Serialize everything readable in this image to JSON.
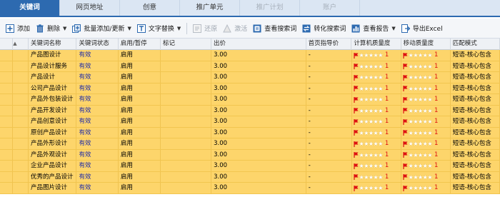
{
  "tabs": [
    {
      "label": "关键词",
      "state": "active"
    },
    {
      "label": "网页地址",
      "state": "normal"
    },
    {
      "label": "创意",
      "state": "normal"
    },
    {
      "label": "推广单元",
      "state": "normal"
    },
    {
      "label": "推广计划",
      "state": "disabled"
    },
    {
      "label": "账户",
      "state": "disabled"
    }
  ],
  "toolbar": {
    "add": "添加",
    "delete": "删除",
    "batch_add": "批量添加/更新",
    "text_replace": "文字替换",
    "restore": "还原",
    "activate": "激活",
    "view_search_terms": "查看搜索词",
    "convert_search_terms": "转化搜索词",
    "view_report": "查看报告",
    "export_excel": "导出Excel"
  },
  "columns": {
    "keyword_name": "关键词名称",
    "keyword_status": "关键词状态",
    "enable_pause": "启用/暂停",
    "mark": "标记",
    "bid": "出价",
    "first_page_bid": "首页指导价",
    "pc_quality": "计算机质量度",
    "mobile_quality": "移动质量度",
    "match_mode": "匹配模式"
  },
  "rows": [
    {
      "keyword": "产品图设计",
      "status": "有效",
      "enabled": "启用",
      "mark": "",
      "bid": "3.00",
      "guide": "-",
      "pc_quality": 1,
      "mobile_quality": 1,
      "match": "短语-核心包含"
    },
    {
      "keyword": "产品设计服务",
      "status": "有效",
      "enabled": "启用",
      "mark": "",
      "bid": "3.00",
      "guide": "-",
      "pc_quality": 1,
      "mobile_quality": 1,
      "match": "短语-核心包含"
    },
    {
      "keyword": "产品设计",
      "status": "有效",
      "enabled": "启用",
      "mark": "",
      "bid": "3.00",
      "guide": "-",
      "pc_quality": 1,
      "mobile_quality": 1,
      "match": "短语-核心包含"
    },
    {
      "keyword": "公司产品设计",
      "status": "有效",
      "enabled": "启用",
      "mark": "",
      "bid": "3.00",
      "guide": "-",
      "pc_quality": 1,
      "mobile_quality": 1,
      "match": "短语-核心包含"
    },
    {
      "keyword": "产品外包装设计",
      "status": "有效",
      "enabled": "启用",
      "mark": "",
      "bid": "3.00",
      "guide": "-",
      "pc_quality": 1,
      "mobile_quality": 1,
      "match": "短语-核心包含"
    },
    {
      "keyword": "产品开发设计",
      "status": "有效",
      "enabled": "启用",
      "mark": "",
      "bid": "3.00",
      "guide": "-",
      "pc_quality": 1,
      "mobile_quality": 1,
      "match": "短语-核心包含"
    },
    {
      "keyword": "产品创意设计",
      "status": "有效",
      "enabled": "启用",
      "mark": "",
      "bid": "3.00",
      "guide": "-",
      "pc_quality": 1,
      "mobile_quality": 1,
      "match": "短语-核心包含"
    },
    {
      "keyword": "原创产品设计",
      "status": "有效",
      "enabled": "启用",
      "mark": "",
      "bid": "3.00",
      "guide": "-",
      "pc_quality": 1,
      "mobile_quality": 1,
      "match": "短语-核心包含"
    },
    {
      "keyword": "产品外形设计",
      "status": "有效",
      "enabled": "启用",
      "mark": "",
      "bid": "3.00",
      "guide": "-",
      "pc_quality": 1,
      "mobile_quality": 1,
      "match": "短语-核心包含"
    },
    {
      "keyword": "产品外观设计",
      "status": "有效",
      "enabled": "启用",
      "mark": "",
      "bid": "3.00",
      "guide": "-",
      "pc_quality": 1,
      "mobile_quality": 1,
      "match": "短语-核心包含"
    },
    {
      "keyword": "企业产品设计",
      "status": "有效",
      "enabled": "启用",
      "mark": "",
      "bid": "3.00",
      "guide": "-",
      "pc_quality": 1,
      "mobile_quality": 1,
      "match": "短语-核心包含"
    },
    {
      "keyword": "优秀的产品设计",
      "status": "有效",
      "enabled": "启用",
      "mark": "",
      "bid": "3.00",
      "guide": "-",
      "pc_quality": 1,
      "mobile_quality": 1,
      "match": "短语-核心包含"
    },
    {
      "keyword": "产品图片设计",
      "status": "有效",
      "enabled": "启用",
      "mark": "",
      "bid": "3.00",
      "guide": "-",
      "pc_quality": 1,
      "mobile_quality": 1,
      "match": "短语-核心包含"
    }
  ],
  "quality_max_stars": 5,
  "colors": {
    "row_bg": "#fdd56b",
    "status": "#1c29a8",
    "accent": "#2d6ab0",
    "quality_number": "#dd1111"
  }
}
